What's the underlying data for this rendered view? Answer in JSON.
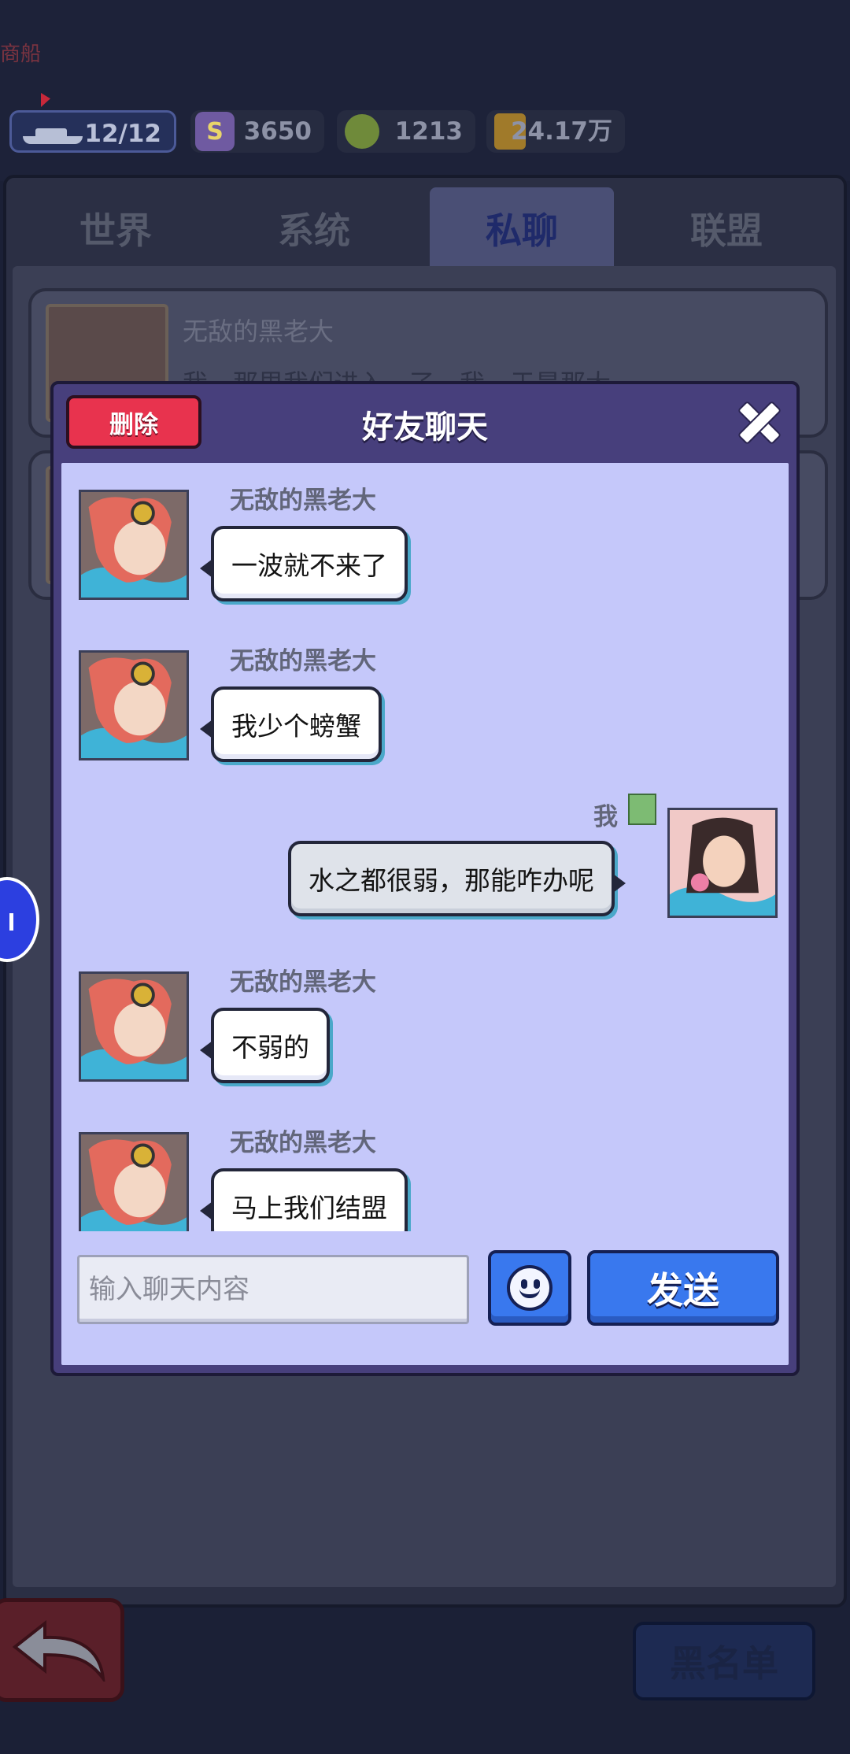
{
  "header": {
    "game_name": "商船",
    "resources": {
      "ships": "12/12",
      "coins": "3650",
      "food": "1213",
      "oil": "24.17万"
    }
  },
  "tabs": [
    {
      "label": "世界"
    },
    {
      "label": "系统"
    },
    {
      "label": "私聊",
      "active": true
    },
    {
      "label": "联盟"
    }
  ],
  "background_list": [
    {
      "name": "无敌的黑老大",
      "preview": "我…那里我们进入…了，我…于是那大"
    }
  ],
  "dialog": {
    "title": "好友聊天",
    "delete_label": "删除",
    "messages": [
      {
        "sender": "无敌的黑老大",
        "text": "一波就不来了",
        "mine": false
      },
      {
        "sender": "无敌的黑老大",
        "text": "我少个螃蟹",
        "mine": false
      },
      {
        "sender": "我",
        "text": "水之都很弱，那能咋办呢",
        "mine": true
      },
      {
        "sender": "无敌的黑老大",
        "text": "不弱的",
        "mine": false
      },
      {
        "sender": "无敌的黑老大",
        "text": "马上我们结盟",
        "mine": false
      }
    ],
    "input_placeholder": "输入聊天内容",
    "send_label": "发送"
  },
  "footer": {
    "blacklist_label": "黑名单"
  },
  "colors": {
    "dialog_frame": "#473f7c",
    "dialog_body": "#c5c8fa",
    "send_button": "#3978ee",
    "delete_button": "#e8334e"
  }
}
